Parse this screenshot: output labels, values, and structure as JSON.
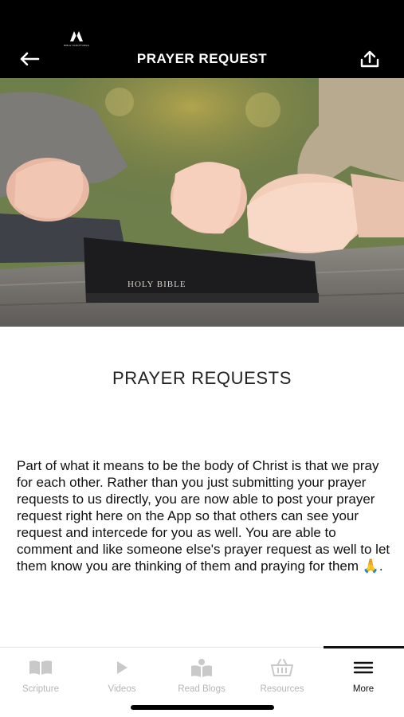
{
  "header": {
    "title": "PRAYER REQUEST",
    "logo_text": "BIBLE SCRIPTURES",
    "back_icon": "arrow-left-icon",
    "share_icon": "share-icon"
  },
  "hero": {
    "book_label": "HOLY BIBLE"
  },
  "content": {
    "section_title": "PRAYER REQUESTS",
    "body": "Part of what it means to be the body of Christ is that we pray for each other. Rather than you just submitting your prayer requests to us directly, you are now able to post your prayer request right here on the App so that others can see your request and intercede for you as well. You are able to comment and like someone else's prayer request as well to let them know you are thinking of them and praying for them 🙏."
  },
  "tabbar": {
    "tabs": [
      {
        "label": "Scripture",
        "icon": "book-icon",
        "active": false
      },
      {
        "label": "Videos",
        "icon": "play-icon",
        "active": false
      },
      {
        "label": "Read Blogs",
        "icon": "reader-icon",
        "active": false
      },
      {
        "label": "Resources",
        "icon": "basket-icon",
        "active": false
      },
      {
        "label": "More",
        "icon": "menu-icon",
        "active": true
      }
    ]
  },
  "colors": {
    "header_bg": "#000000",
    "inactive_tab": "#b5b5b5",
    "active_tab": "#111111"
  }
}
